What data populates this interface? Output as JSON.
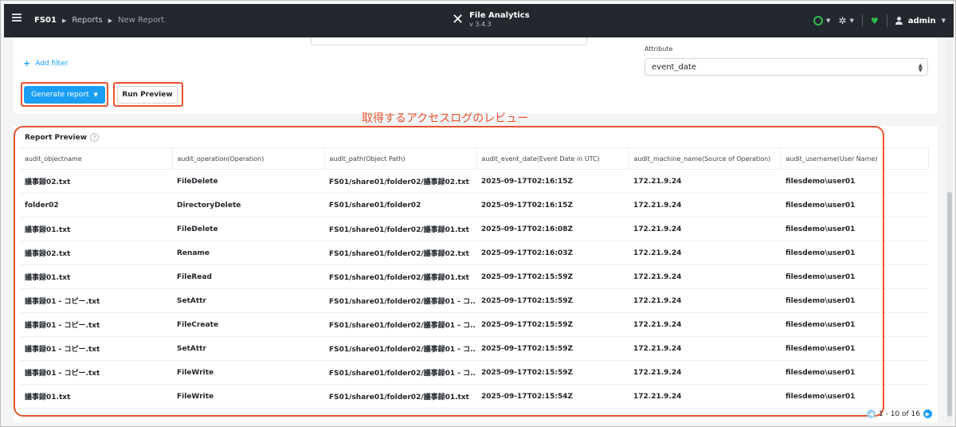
{
  "topbar": {
    "breadcrumb": [
      "FS01",
      "Reports",
      "New Report"
    ],
    "app_name": "File Analytics",
    "version": "v 3.4.3",
    "user": "admin",
    "status_color": "#2fbf4d"
  },
  "filters": {
    "add_filter_label": "Add filter",
    "attribute_label": "Attribute",
    "attribute_value": "event_date"
  },
  "actions": {
    "generate_label": "Generate report",
    "run_preview_label": "Run Preview"
  },
  "annotation": "取得するアクセスログのレビュー",
  "preview": {
    "title": "Report Preview",
    "columns": [
      "audit_objectname",
      "audit_operation(Operation)",
      "audit_path(Object Path)",
      "audit_event_date(Event Date in UTC)",
      "audit_machine_name(Source of Operation)",
      "audit_username(User Name)"
    ],
    "rows": [
      [
        "議事録02.txt",
        "FileDelete",
        "FS01/share01/folder02/議事録02.txt",
        "2025-09-17T02:16:15Z",
        "172.21.9.24",
        "filesdemo\\user01"
      ],
      [
        "folder02",
        "DirectoryDelete",
        "FS01/share01/folder02",
        "2025-09-17T02:16:15Z",
        "172.21.9.24",
        "filesdemo\\user01"
      ],
      [
        "議事録01.txt",
        "FileDelete",
        "FS01/share01/folder02/議事録01.txt",
        "2025-09-17T02:16:08Z",
        "172.21.9.24",
        "filesdemo\\user01"
      ],
      [
        "議事録02.txt",
        "Rename",
        "FS01/share01/folder02/議事録02.txt",
        "2025-09-17T02:16:03Z",
        "172.21.9.24",
        "filesdemo\\user01"
      ],
      [
        "議事録01.txt",
        "FileRead",
        "FS01/share01/folder02/議事録01.txt",
        "2025-09-17T02:15:59Z",
        "172.21.9.24",
        "filesdemo\\user01"
      ],
      [
        "議事録01 - コピー.txt",
        "SetAttr",
        "FS01/share01/folder02/議事録01 - コ...",
        "2025-09-17T02:15:59Z",
        "172.21.9.24",
        "filesdemo\\user01"
      ],
      [
        "議事録01 - コピー.txt",
        "FileCreate",
        "FS01/share01/folder02/議事録01 - コ...",
        "2025-09-17T02:15:59Z",
        "172.21.9.24",
        "filesdemo\\user01"
      ],
      [
        "議事録01 - コピー.txt",
        "SetAttr",
        "FS01/share01/folder02/議事録01 - コ...",
        "2025-09-17T02:15:59Z",
        "172.21.9.24",
        "filesdemo\\user01"
      ],
      [
        "議事録01 - コピー.txt",
        "FileWrite",
        "FS01/share01/folder02/議事録01 - コ...",
        "2025-09-17T02:15:59Z",
        "172.21.9.24",
        "filesdemo\\user01"
      ],
      [
        "議事録01.txt",
        "FileWrite",
        "FS01/share01/folder02/議事録01.txt",
        "2025-09-17T02:15:54Z",
        "172.21.9.24",
        "filesdemo\\user01"
      ]
    ],
    "pagination": "1 - 10 of 16"
  },
  "accent_color": "#1a9ef5",
  "highlight_color": "#e8522f"
}
